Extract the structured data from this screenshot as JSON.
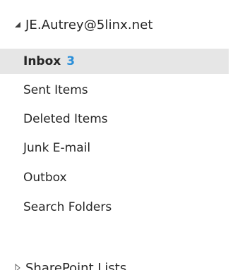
{
  "account": {
    "email": "JE.Autrey@5linx.net",
    "expanded_icon": "triangle-expanded-icon"
  },
  "folders": [
    {
      "label": "Inbox",
      "count": "3",
      "selected": true
    },
    {
      "label": "Sent Items"
    },
    {
      "label": "Deleted Items"
    },
    {
      "label": "Junk E-mail"
    },
    {
      "label": "Outbox"
    },
    {
      "label": "Search Folders"
    }
  ],
  "sharepoint": {
    "label": "SharePoint Lists",
    "collapsed_icon": "triangle-collapsed-icon"
  },
  "colors": {
    "selected_bg": "#e6e6e6",
    "unread_count": "#2b8fd9",
    "text": "#262626"
  }
}
